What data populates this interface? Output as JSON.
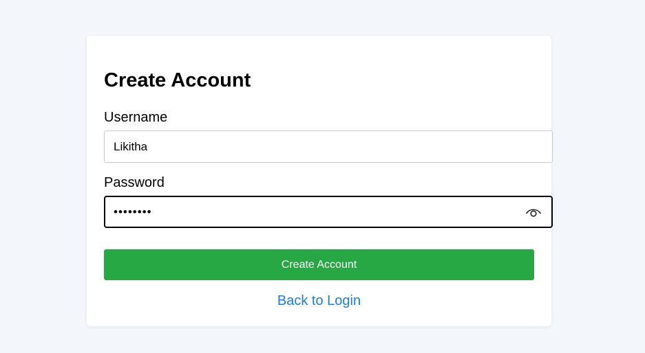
{
  "form": {
    "title": "Create Account",
    "username_label": "Username",
    "username_value": "Likitha",
    "password_label": "Password",
    "password_value": "••••••••",
    "password_toggle_icon": "eye-icon",
    "submit_label": "Create Account",
    "back_link_label": "Back to Login"
  },
  "colors": {
    "page_background": "#f3f6fa",
    "card_background": "#ffffff",
    "submit_button": "#28a745",
    "link": "#1a7fe0"
  }
}
